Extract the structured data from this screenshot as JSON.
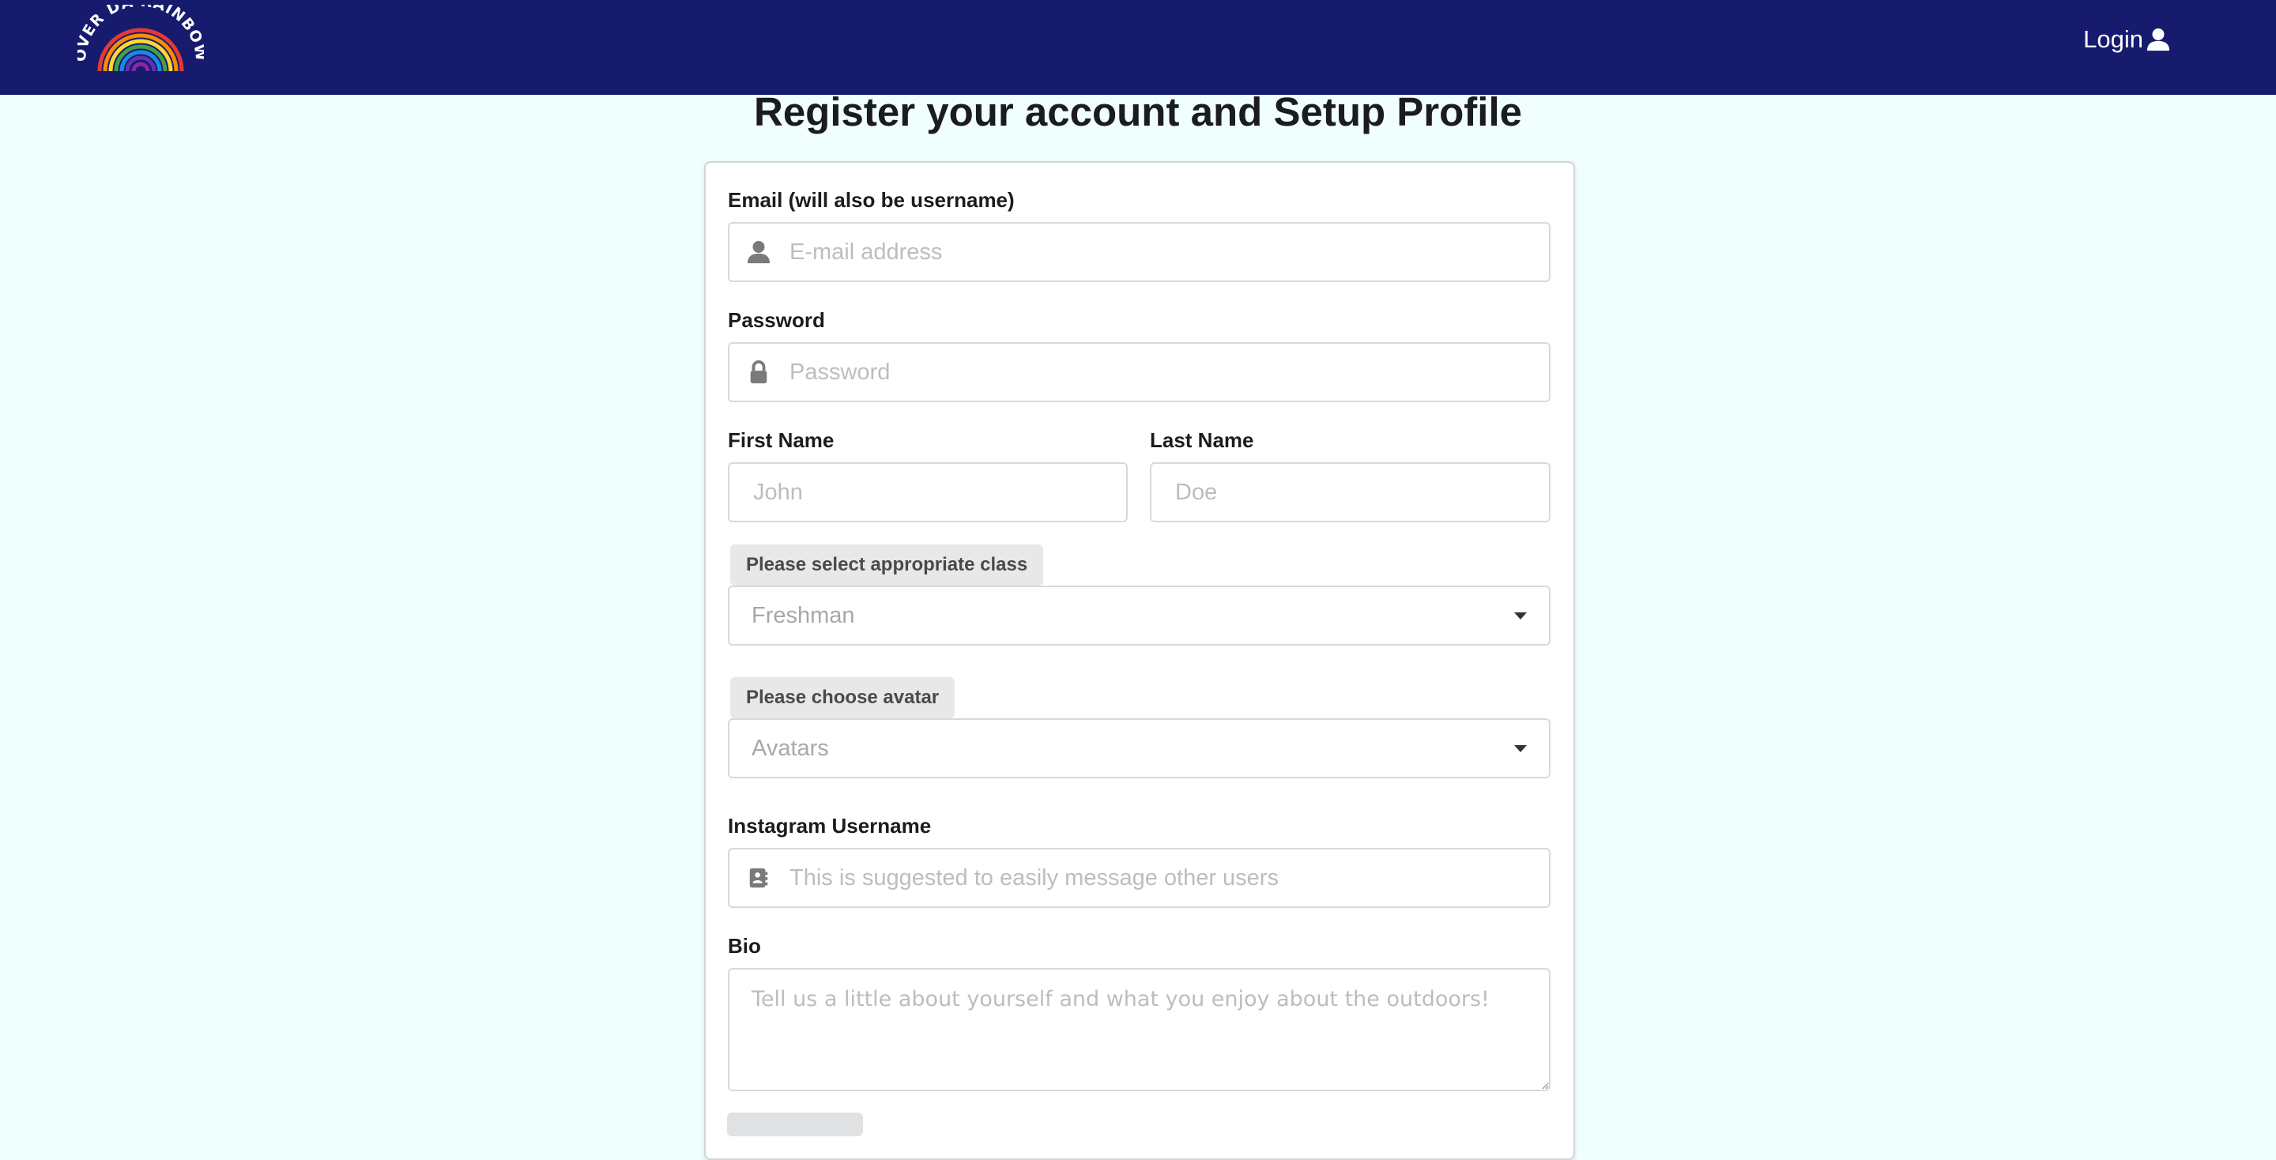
{
  "navbar": {
    "logo_text": "OVER DA RAINBOW",
    "login_label": "Login"
  },
  "page_title": "Register your account and Setup Profile",
  "form": {
    "email": {
      "label": "Email (will also be username)",
      "placeholder": "E-mail address",
      "icon": "user-icon"
    },
    "password": {
      "label": "Password",
      "placeholder": "Password",
      "icon": "lock-icon"
    },
    "first_name": {
      "label": "First Name",
      "placeholder": "John"
    },
    "last_name": {
      "label": "Last Name",
      "placeholder": "Doe"
    },
    "class_select": {
      "prompt": "Please select appropriate class",
      "value": "Freshman"
    },
    "avatar_select": {
      "prompt": "Please choose avatar",
      "value": "Avatars"
    },
    "instagram": {
      "label": "Instagram Username",
      "placeholder": "This is suggested to easily message other users",
      "icon": "address-book-icon"
    },
    "bio": {
      "label": "Bio",
      "placeholder": "Tell us a little about yourself and what you enjoy about the outdoors!"
    }
  },
  "colors": {
    "navbar": "#161b6e",
    "background": "#f0fffe",
    "rainbow": [
      "#e53935",
      "#fb8c00",
      "#fdd835",
      "#43a047",
      "#1e88e5",
      "#5e35b1"
    ]
  }
}
